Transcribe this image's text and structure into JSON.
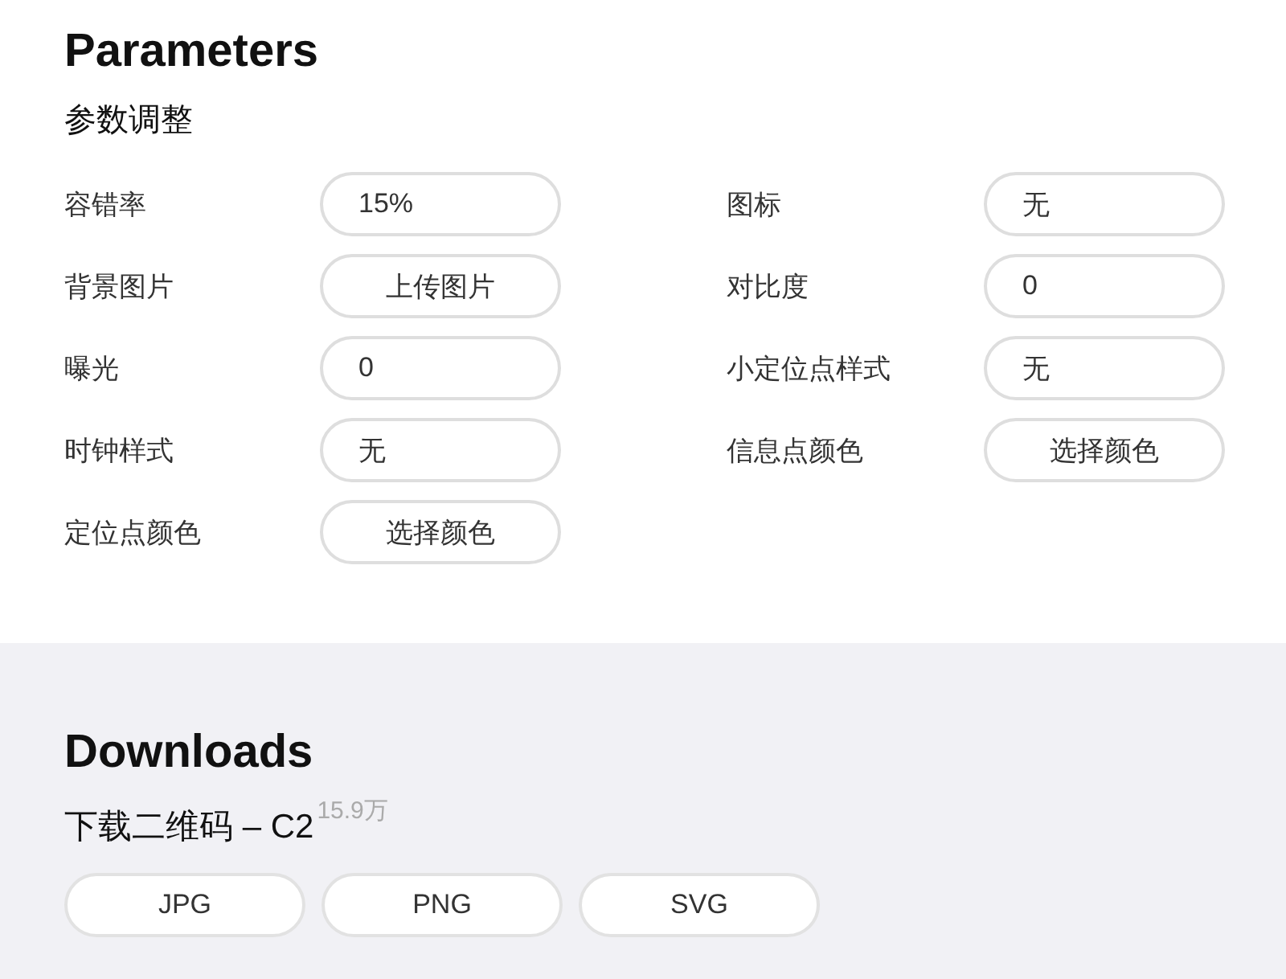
{
  "parameters": {
    "title": "Parameters",
    "subtitle": "参数调整",
    "fields": [
      {
        "label": "容错率",
        "kind": "input",
        "value": "15%"
      },
      {
        "label": "图标",
        "kind": "input",
        "value": "无"
      },
      {
        "label": "背景图片",
        "kind": "button",
        "value": "上传图片"
      },
      {
        "label": "对比度",
        "kind": "input",
        "value": "0"
      },
      {
        "label": "曝光",
        "kind": "input",
        "value": "0"
      },
      {
        "label": "小定位点样式",
        "kind": "input",
        "value": "无"
      },
      {
        "label": "时钟样式",
        "kind": "input",
        "value": "无"
      },
      {
        "label": "信息点颜色",
        "kind": "button",
        "value": "选择颜色"
      },
      {
        "label": "定位点颜色",
        "kind": "button",
        "value": "选择颜色"
      }
    ]
  },
  "downloads": {
    "title": "Downloads",
    "subtitle": "下载二维码 – C2",
    "count": "15.9万",
    "buttons": [
      "JPG",
      "PNG",
      "SVG"
    ]
  }
}
